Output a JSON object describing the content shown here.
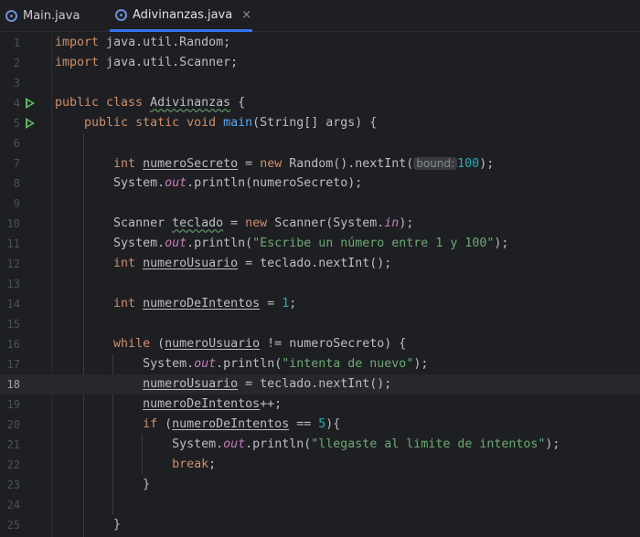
{
  "tabs": [
    {
      "label": "Main.java",
      "icon": "java-class-icon",
      "active": false
    },
    {
      "label": "Adivinanzas.java",
      "icon": "java-class-icon",
      "active": true,
      "close": "×"
    }
  ],
  "editor": {
    "current_line": 18,
    "line_numbers": [
      "1",
      "2",
      "3",
      "4",
      "5",
      "6",
      "7",
      "8",
      "9",
      "10",
      "11",
      "12",
      "13",
      "14",
      "15",
      "16",
      "17",
      "18",
      "19",
      "20",
      "21",
      "22",
      "23",
      "24",
      "25"
    ],
    "inlay_hint": "bound:",
    "code": {
      "l1_kw": "import",
      "l1_rest": " java.util.Random;",
      "l2_kw": "import",
      "l2_rest": " java.util.Scanner;",
      "l4_kw": "public class ",
      "l4_name": "Adivinanzas",
      "l4_rest": " {",
      "l5_kw": "public static void ",
      "l5_fn": "main",
      "l5_rest": "(String[] args) {",
      "l7_kw": "int ",
      "l7_var": "numeroSecreto",
      "l7_mid": " = ",
      "l7_new": "new",
      "l7_call": " Random().nextInt(",
      "l7_num": "100",
      "l7_end": ");",
      "l8_a": "System.",
      "l8_out": "out",
      "l8_b": ".println(numeroSecreto);",
      "l10_a": "Scanner ",
      "l10_var": "teclado",
      "l10_mid": " = ",
      "l10_new": "new",
      "l10_b": " Scanner(System.",
      "l10_in": "in",
      "l10_end": ");",
      "l11_a": "System.",
      "l11_out": "out",
      "l11_b": ".println(",
      "l11_str": "\"Escribe un número entre 1 y 100\"",
      "l11_end": ");",
      "l12_kw": "int ",
      "l12_var": "numeroUsuario",
      "l12_rest": " = teclado.nextInt();",
      "l14_kw": "int ",
      "l14_var": "numeroDeIntentos",
      "l14_mid": " = ",
      "l14_num": "1",
      "l14_end": ";",
      "l16_kw": "while",
      "l16_a": " (",
      "l16_var": "numeroUsuario",
      "l16_rest": " != numeroSecreto) {",
      "l17_a": "System.",
      "l17_out": "out",
      "l17_b": ".println(",
      "l17_str": "\"intenta de nuevo\"",
      "l17_end": ");",
      "l18_var": "numeroUsuario",
      "l18_rest": " = teclado.nextInt();",
      "l19_var": "numeroDeIntentos",
      "l19_rest": "++;",
      "l20_kw": "if",
      "l20_a": " (",
      "l20_var": "numeroDeIntentos",
      "l20_mid": " == ",
      "l20_num": "5",
      "l20_end": "){",
      "l21_a": "System.",
      "l21_out": "out",
      "l21_b": ".println(",
      "l21_str": "\"llegaste al limite de intentos\"",
      "l21_end": ");",
      "l22_kw": "break",
      "l22_end": ";",
      "l23": "}",
      "l25": "}"
    }
  }
}
